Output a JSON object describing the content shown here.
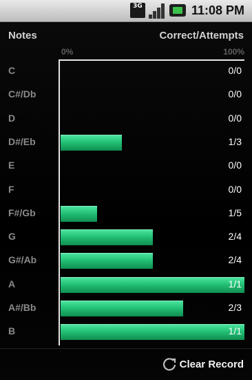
{
  "status_bar": {
    "network": "3G",
    "time": "11:08 PM"
  },
  "header": {
    "notes_label": "Notes",
    "ratio_label": "Correct/Attempts",
    "scale_min": "0%",
    "scale_max": "100%"
  },
  "colors": {
    "bar": "#24c277",
    "background": "#000000"
  },
  "notes": [
    {
      "name": "C",
      "correct": 0,
      "attempts": 0,
      "ratio": "0/0",
      "fraction": 0
    },
    {
      "name": "C#/Db",
      "correct": 0,
      "attempts": 0,
      "ratio": "0/0",
      "fraction": 0
    },
    {
      "name": "D",
      "correct": 0,
      "attempts": 0,
      "ratio": "0/0",
      "fraction": 0
    },
    {
      "name": "D#/Eb",
      "correct": 1,
      "attempts": 3,
      "ratio": "1/3",
      "fraction": 0.333
    },
    {
      "name": "E",
      "correct": 0,
      "attempts": 0,
      "ratio": "0/0",
      "fraction": 0
    },
    {
      "name": "F",
      "correct": 0,
      "attempts": 0,
      "ratio": "0/0",
      "fraction": 0
    },
    {
      "name": "F#/Gb",
      "correct": 1,
      "attempts": 5,
      "ratio": "1/5",
      "fraction": 0.2
    },
    {
      "name": "G",
      "correct": 2,
      "attempts": 4,
      "ratio": "2/4",
      "fraction": 0.5
    },
    {
      "name": "G#/Ab",
      "correct": 2,
      "attempts": 4,
      "ratio": "2/4",
      "fraction": 0.5
    },
    {
      "name": "A",
      "correct": 1,
      "attempts": 1,
      "ratio": "1/1",
      "fraction": 1
    },
    {
      "name": "A#/Bb",
      "correct": 2,
      "attempts": 3,
      "ratio": "2/3",
      "fraction": 0.667
    },
    {
      "name": "B",
      "correct": 1,
      "attempts": 1,
      "ratio": "1/1",
      "fraction": 1
    }
  ],
  "footer": {
    "clear_label": "Clear Record"
  }
}
